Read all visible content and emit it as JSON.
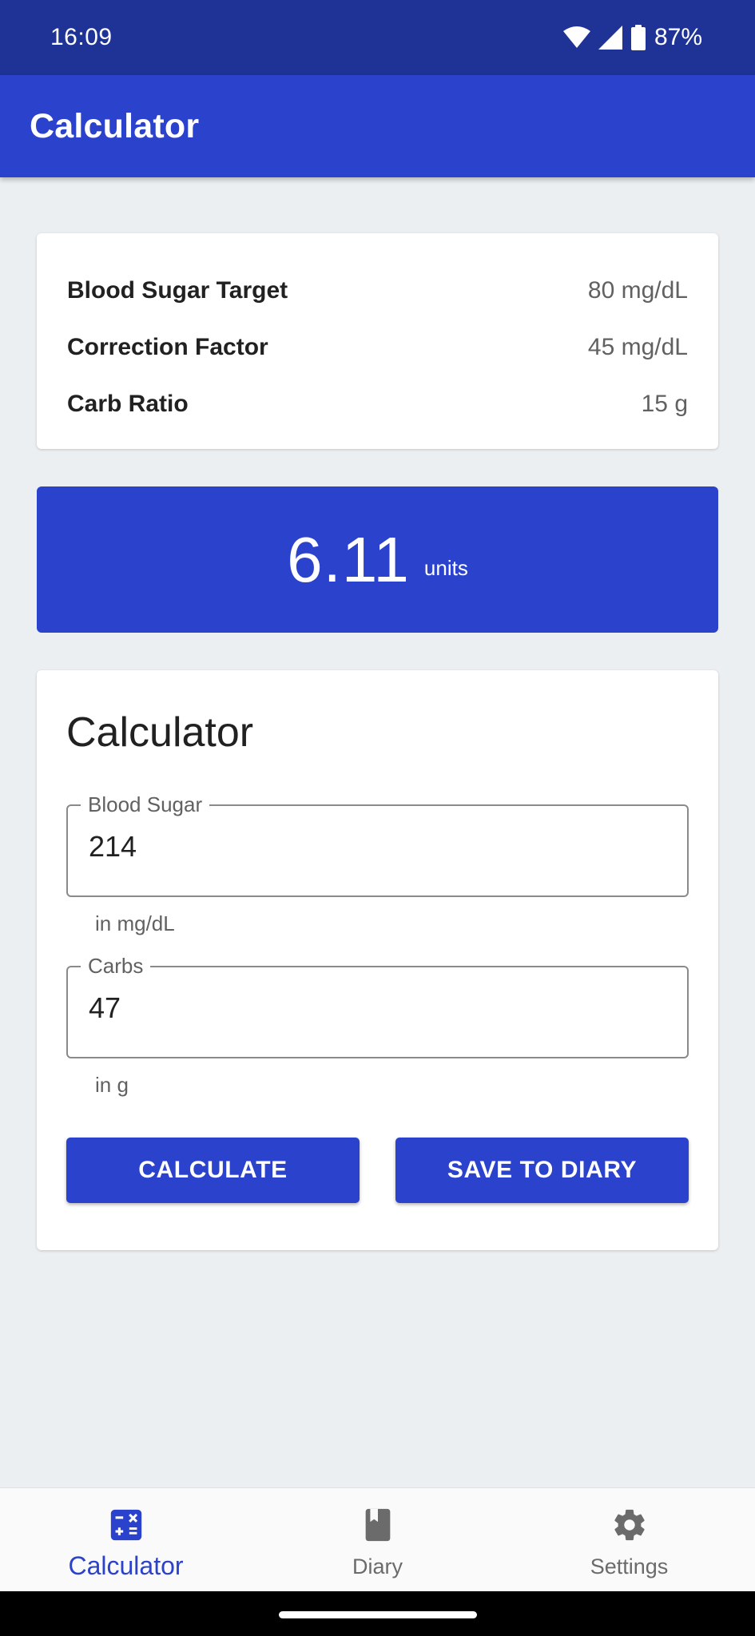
{
  "status_bar": {
    "time": "16:09",
    "battery": "87%"
  },
  "app_bar": {
    "title": "Calculator"
  },
  "settings": {
    "rows": [
      {
        "label": "Blood Sugar Target",
        "value": "80 mg/dL"
      },
      {
        "label": "Correction Factor",
        "value": "45 mg/dL"
      },
      {
        "label": "Carb Ratio",
        "value": "15 g"
      }
    ]
  },
  "result": {
    "value": "6.11",
    "unit": "units"
  },
  "calculator": {
    "title": "Calculator",
    "blood_sugar": {
      "label": "Blood Sugar",
      "value": "214",
      "helper": "in mg/dL"
    },
    "carbs": {
      "label": "Carbs",
      "value": "47",
      "helper": "in g"
    },
    "calculate_label": "CALCULATE",
    "save_label": "SAVE TO DIARY"
  },
  "bottom_nav": {
    "items": [
      {
        "label": "Calculator",
        "icon": "calculator-icon",
        "active": true
      },
      {
        "label": "Diary",
        "icon": "book-icon",
        "active": false
      },
      {
        "label": "Settings",
        "icon": "gear-icon",
        "active": false
      }
    ]
  },
  "colors": {
    "primary": "#2b42cc",
    "primary_dark": "#1f3397",
    "background": "#eceff1"
  }
}
